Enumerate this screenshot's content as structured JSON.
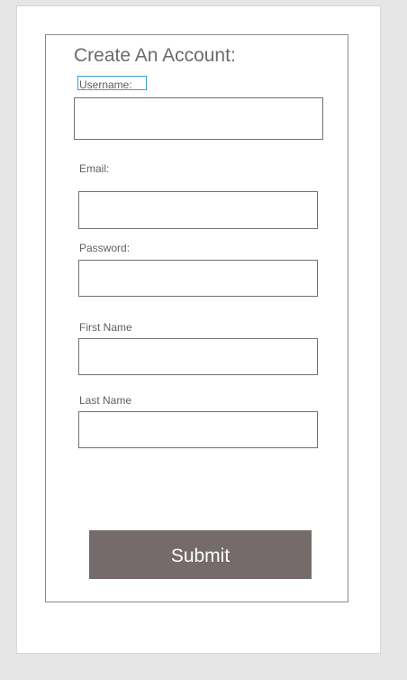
{
  "form": {
    "title": "Create An Account:",
    "fields": {
      "username": {
        "label": "Username:",
        "value": "",
        "placeholder": ""
      },
      "email": {
        "label": "Email:",
        "value": "",
        "placeholder": ""
      },
      "password": {
        "label": "Password:",
        "value": "",
        "placeholder": ""
      },
      "first_name": {
        "label": "First Name",
        "value": "",
        "placeholder": ""
      },
      "last_name": {
        "label": "Last Name",
        "value": "",
        "placeholder": ""
      }
    },
    "submit_label": "Submit"
  },
  "colors": {
    "background": "#e6e6e6",
    "page": "#ffffff",
    "button": "#756b6a",
    "focus_outline": "#3c9fd6"
  }
}
